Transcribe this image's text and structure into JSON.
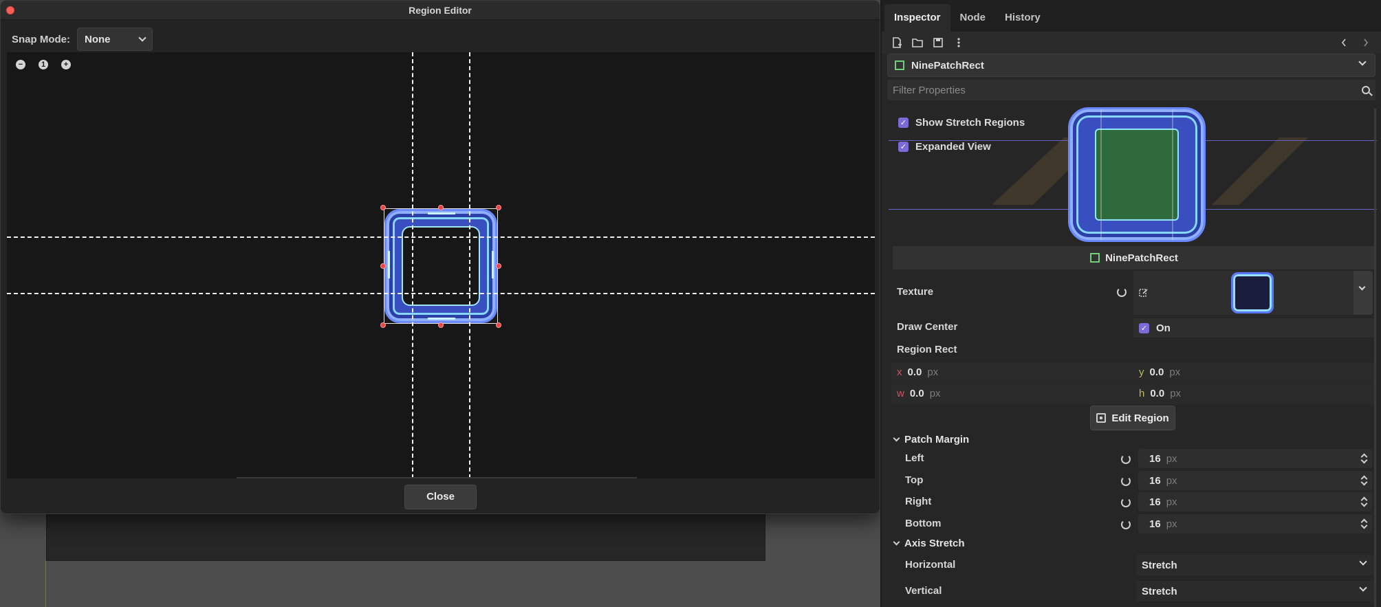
{
  "dialog": {
    "title": "Region Editor",
    "snap_label": "Snap Mode:",
    "snap_value": "None",
    "zoom_reset": "1",
    "close_label": "Close"
  },
  "inspector": {
    "tabs": [
      "Inspector",
      "Node",
      "History"
    ],
    "node_type": "NinePatchRect",
    "filter_placeholder": "Filter Properties",
    "show_stretch_regions": "Show Stretch Regions",
    "expanded_view": "Expanded View",
    "section_title": "NinePatchRect",
    "texture_label": "Texture",
    "draw_center_label": "Draw Center",
    "draw_center_value": "On",
    "region_rect_label": "Region Rect",
    "region_rect": {
      "x_axis": "x",
      "x": "0.0",
      "y_axis": "y",
      "y": "0.0",
      "w_axis": "w",
      "w": "0.0",
      "h_axis": "h",
      "h": "0.0",
      "unit": "px"
    },
    "edit_region_label": "Edit Region",
    "patch_margin": {
      "title": "Patch Margin",
      "fields": [
        {
          "label": "Left",
          "value": "16",
          "unit": "px"
        },
        {
          "label": "Top",
          "value": "16",
          "unit": "px"
        },
        {
          "label": "Right",
          "value": "16",
          "unit": "px"
        },
        {
          "label": "Bottom",
          "value": "16",
          "unit": "px"
        }
      ]
    },
    "axis_stretch": {
      "title": "Axis Stretch",
      "horizontal_label": "Horizontal",
      "horizontal_value": "Stretch",
      "vertical_label": "Vertical",
      "vertical_value": "Stretch"
    }
  },
  "colors": {
    "accent": "#7c6bd6",
    "handle": "#e84545",
    "texture_blue": "#3a4fbf",
    "close_dot": "#ff5f57"
  }
}
